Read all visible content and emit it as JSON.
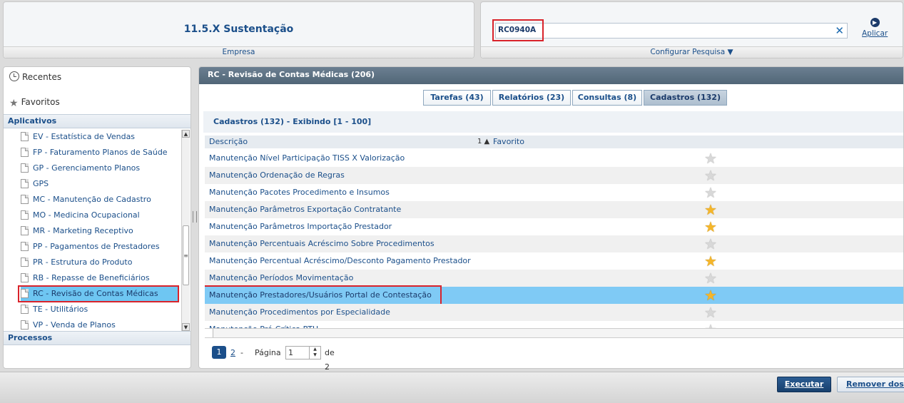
{
  "company": {
    "title": "11.5.X Sustentação",
    "footer": "Empresa"
  },
  "search": {
    "value": "RC0940A",
    "clear": "✕",
    "apply_label": "Aplicar",
    "footer": "Configurar Pesquisa ▼"
  },
  "left": {
    "recentes": "Recentes",
    "favoritos": "Favoritos",
    "aplicativos": "Aplicativos",
    "processos": "Processos",
    "apps": [
      "EV - Estatística de Vendas",
      "FP - Faturamento Planos de Saúde",
      "GP - Gerenciamento Planos",
      "GPS",
      "MC - Manutenção de Cadastro",
      "MO - Medicina Ocupacional",
      "MR - Marketing Receptivo",
      "PP - Pagamentos de Prestadores",
      "PR - Estrutura do Produto",
      "RB - Repasse de Beneficiários",
      "RC - Revisão de Contas Médicas",
      "TE - Utilitários",
      "VP - Venda de Planos"
    ]
  },
  "main": {
    "header": "RC - Revisão de Contas Médicas (206)",
    "tabs": [
      "Tarefas (43)",
      "Relatórios (23)",
      "Consultas (8)",
      "Cadastros (132)"
    ],
    "list_header": "Cadastros (132) - Exibindo [1 - 100]",
    "col_descricao": "Descrição",
    "col_sort": "1 ▲",
    "col_favorito": "Favorito",
    "rows": [
      {
        "label": "Manutenção Nível Participação TISS X Valorização",
        "fav": false
      },
      {
        "label": "Manutenção Ordenação de Regras",
        "fav": false
      },
      {
        "label": "Manutenção Pacotes Procedimento e Insumos",
        "fav": false
      },
      {
        "label": "Manutenção Parâmetros Exportação Contratante",
        "fav": true
      },
      {
        "label": "Manutenção Parâmetros Importação Prestador",
        "fav": true
      },
      {
        "label": "Manutenção Percentuais Acréscimo Sobre Procedimentos",
        "fav": false
      },
      {
        "label": "Manutenção Percentual Acréscimo/Desconto Pagamento Prestador",
        "fav": true
      },
      {
        "label": "Manutenção Períodos Movimentação",
        "fav": false
      },
      {
        "label": "Manutenção Prestadores/Usuários Portal de Contestação",
        "fav": true
      },
      {
        "label": "Manutenção Procedimentos por Especialidade",
        "fav": false
      },
      {
        "label": "Manutenção Pré-Crítica PTU",
        "fav": false
      }
    ],
    "pager": {
      "current": "1",
      "page2": "2",
      "dash": "-",
      "label": "Página",
      "input": "1",
      "of": "de 2"
    }
  },
  "buttons": {
    "execute": "Executar",
    "remove": "Remover dos favoritos"
  }
}
